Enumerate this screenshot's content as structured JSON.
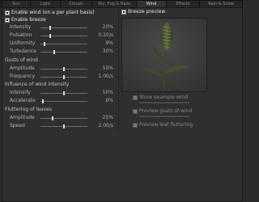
{
  "tabs": [
    {
      "label": "Sun",
      "active": false
    },
    {
      "label": "Light",
      "active": false
    },
    {
      "label": "Clouds",
      "active": false
    },
    {
      "label": "Sky, Fog & Haze",
      "active": false
    },
    {
      "label": "Wind",
      "active": true
    },
    {
      "label": "Effects",
      "active": false
    },
    {
      "label": "Rain & Snow",
      "active": false
    }
  ],
  "enable_wind": {
    "label": "Enable wind (on a per plant basis)",
    "checked": true
  },
  "enable_breeze": {
    "label": "Enable breeze",
    "checked": true
  },
  "breeze": {
    "intensity": {
      "label": "Intensity",
      "value": "20%",
      "level": 0.2
    },
    "pulsation": {
      "label": "Pulsation",
      "value": "0.20/s",
      "level": 0.2
    },
    "uniformity": {
      "label": "Uniformity",
      "value": "9%",
      "level": 0.09
    },
    "turbulence": {
      "label": "Turbulence",
      "value": "30%",
      "level": 0.3
    }
  },
  "gusts": {
    "header": "Gusts of wind",
    "amplitude": {
      "label": "Amplitude",
      "value": "50%",
      "level": 0.5
    },
    "frequency": {
      "label": "Frequency",
      "value": "1.00/s",
      "level": 0.5
    }
  },
  "influence": {
    "header": "Influence of wind intensity",
    "intensify": {
      "label": "Intensify",
      "value": "50%",
      "level": 0.5
    },
    "accelerate": {
      "label": "Accelerate",
      "value": "6%",
      "level": 0.06
    }
  },
  "flutter": {
    "header": "Fluttering of leaves",
    "amplitude": {
      "label": "Amplitude",
      "value": "25%",
      "level": 0.25
    },
    "speed": {
      "label": "Speed",
      "value": "2.00/s",
      "level": 0.5
    }
  },
  "preview": {
    "header": {
      "label": "Breeze preview",
      "checked": true
    },
    "show_example_wind": {
      "label": "Show example wind",
      "checked": false
    },
    "preview_gusts": {
      "label": "Preview gusts of wind",
      "checked": false
    },
    "preview_leaf": {
      "label": "Preview leaf fluttering",
      "checked": false
    }
  }
}
